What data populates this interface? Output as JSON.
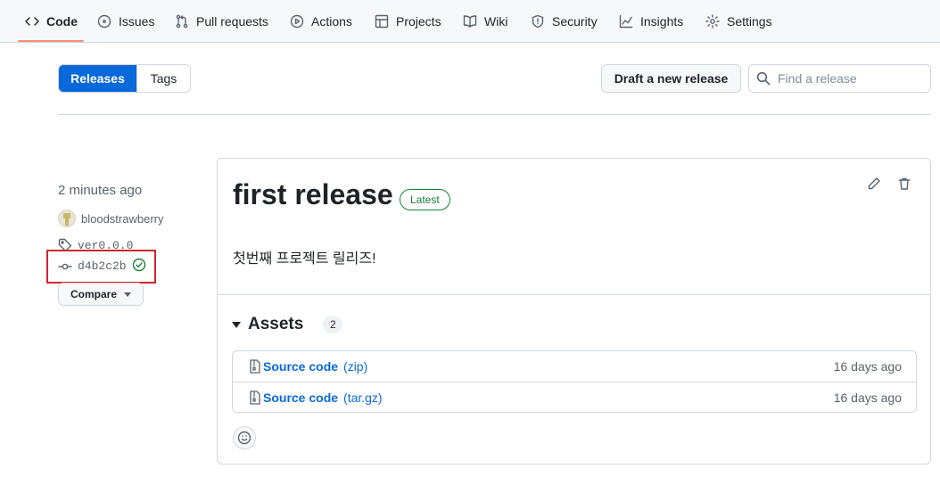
{
  "nav": {
    "tabs": [
      {
        "label": "Code",
        "icon": "code-icon"
      },
      {
        "label": "Issues",
        "icon": "issue-opened-icon"
      },
      {
        "label": "Pull requests",
        "icon": "git-pull-request-icon"
      },
      {
        "label": "Actions",
        "icon": "play-icon"
      },
      {
        "label": "Projects",
        "icon": "table-icon"
      },
      {
        "label": "Wiki",
        "icon": "book-icon"
      },
      {
        "label": "Security",
        "icon": "shield-icon"
      },
      {
        "label": "Insights",
        "icon": "graph-icon"
      },
      {
        "label": "Settings",
        "icon": "gear-icon"
      }
    ],
    "active": "Code"
  },
  "subnav": {
    "releases_label": "Releases",
    "tags_label": "Tags",
    "draft_label": "Draft a new release",
    "search_placeholder": "Find a release"
  },
  "meta": {
    "time": "2 minutes ago",
    "author": "bloodstrawberry",
    "tag": "ver0.0.0",
    "commit": "d4b2c2b",
    "compare_label": "Compare"
  },
  "release": {
    "title": "first release",
    "badge": "Latest",
    "body": "첫번째 프로젝트 릴리즈!",
    "assets_label": "Assets",
    "assets_count": "2",
    "assets": [
      {
        "name": "Source code",
        "ext": "(zip)",
        "date": "16 days ago"
      },
      {
        "name": "Source code",
        "ext": "(tar.gz)",
        "date": "16 days ago"
      }
    ]
  },
  "colors": {
    "accent": "#0969da",
    "success": "#1a7f37",
    "highlight": "#d1242f",
    "tab_underline": "#fd8c73"
  }
}
